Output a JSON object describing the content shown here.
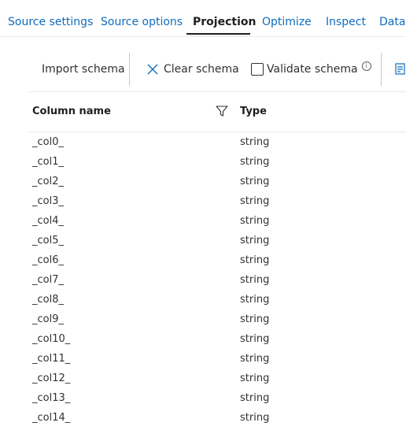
{
  "tabs": [
    {
      "label": "Source settings"
    },
    {
      "label": "Source options"
    },
    {
      "label": "Projection"
    },
    {
      "label": "Optimize"
    },
    {
      "label": "Inspect"
    },
    {
      "label": "Data preview"
    }
  ],
  "active_tab": "Projection",
  "toolbar": {
    "import_label": "Import schema",
    "clear_label": "Clear schema",
    "validate_label": "Validate schema",
    "validate_checked": false
  },
  "table": {
    "headers": {
      "column_name": "Column name",
      "type": "Type"
    },
    "rows": [
      {
        "name": "_col0_",
        "type": "string"
      },
      {
        "name": "_col1_",
        "type": "string"
      },
      {
        "name": "_col2_",
        "type": "string"
      },
      {
        "name": "_col3_",
        "type": "string"
      },
      {
        "name": "_col4_",
        "type": "string"
      },
      {
        "name": "_col5_",
        "type": "string"
      },
      {
        "name": "_col6_",
        "type": "string"
      },
      {
        "name": "_col7_",
        "type": "string"
      },
      {
        "name": "_col8_",
        "type": "string"
      },
      {
        "name": "_col9_",
        "type": "string"
      },
      {
        "name": "_col10_",
        "type": "string"
      },
      {
        "name": "_col11_",
        "type": "string"
      },
      {
        "name": "_col12_",
        "type": "string"
      },
      {
        "name": "_col13_",
        "type": "string"
      },
      {
        "name": "_col14_",
        "type": "string"
      }
    ]
  },
  "colors": {
    "link": "#0f6cbd",
    "text": "#323130",
    "border": "#edebe9"
  }
}
